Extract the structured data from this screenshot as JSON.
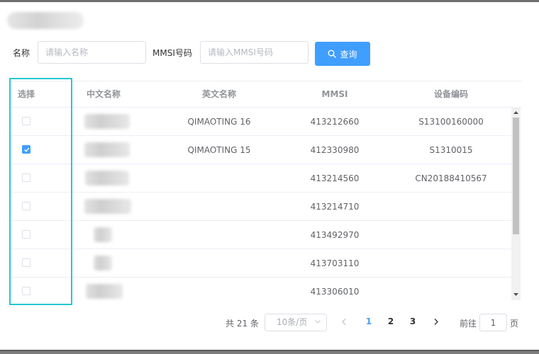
{
  "form": {
    "name_label": "名称",
    "name_placeholder": "请输入名称",
    "mmsi_label": "MMSI号码",
    "mmsi_placeholder": "请输入MMSI号码",
    "query_label": "查询"
  },
  "table": {
    "headers": {
      "select": "选择",
      "cn_name": "中文名称",
      "en_name": "英文名称",
      "mmsi": "MMSI",
      "device_code": "设备编码"
    },
    "rows": [
      {
        "checked": false,
        "en_name": "QIMAOTING 16",
        "mmsi": "413212660",
        "device_code": "S13100160000"
      },
      {
        "checked": true,
        "en_name": "QIMAOTING 15",
        "mmsi": "412330980",
        "device_code": "S1310015"
      },
      {
        "checked": false,
        "en_name": "",
        "mmsi": "413214560",
        "device_code": "CN20188410567"
      },
      {
        "checked": false,
        "en_name": "",
        "mmsi": "413214710",
        "device_code": ""
      },
      {
        "checked": false,
        "en_name": "",
        "mmsi": "413492970",
        "device_code": ""
      },
      {
        "checked": false,
        "en_name": "",
        "mmsi": "413703110",
        "device_code": ""
      },
      {
        "checked": false,
        "en_name": "",
        "mmsi": "413306010",
        "device_code": ""
      }
    ]
  },
  "pagination": {
    "total": "共 21 条",
    "page_size": "10条/页",
    "pages": [
      "1",
      "2",
      "3"
    ],
    "current_page": "1",
    "goto_label": "前往",
    "goto_value": "1",
    "page_suffix": "页"
  },
  "colors": {
    "primary": "#409eff",
    "highlight": "#26c6d4"
  }
}
